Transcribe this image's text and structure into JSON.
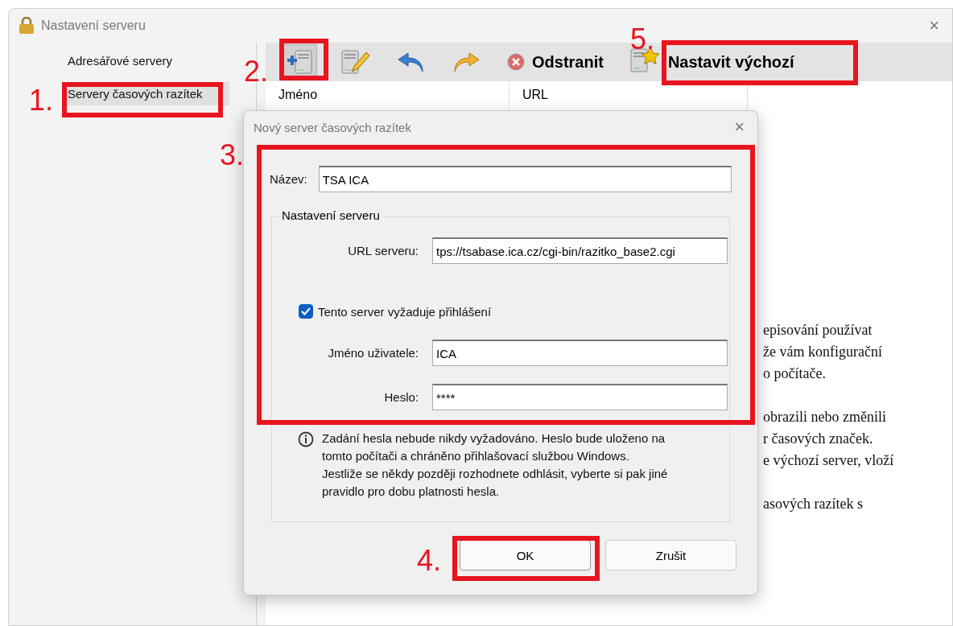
{
  "window": {
    "title": "Nastavení serveru",
    "close": "×"
  },
  "sidebar": {
    "items": [
      {
        "label": "Adresářové servery",
        "selected": false
      },
      {
        "label": "Servery časových razítek",
        "selected": true
      }
    ]
  },
  "toolbar": [
    {
      "kind": "add",
      "selected": true
    },
    {
      "kind": "edit",
      "selected": false
    },
    {
      "kind": "undo",
      "selected": false
    },
    {
      "kind": "redo",
      "selected": false
    },
    {
      "kind": "delete",
      "label": "Odstranit",
      "selected": false
    },
    {
      "kind": "default",
      "label": "Nastavit výchozí",
      "selected": false
    }
  ],
  "table": {
    "columns": [
      "Jméno",
      "URL"
    ]
  },
  "help_text": [
    {
      "lines": [
        "episování používat",
        "že vám konfigurační",
        "o počítače."
      ]
    },
    {
      "lines": [
        "obrazili nebo změnili",
        "r časových značek.",
        "e výchozí server, vloží"
      ]
    },
    {
      "lines": [
        "asových razítek s"
      ]
    }
  ],
  "dialog": {
    "title": "Nový server časových razítek",
    "close": "×",
    "name": {
      "label": "Název:",
      "value": "TSA ICA"
    },
    "group_title": "Nastavení serveru",
    "url": {
      "label": "URL serveru:",
      "value": "tps://tsabase.ica.cz/cgi-bin/razitko_base2.cgi"
    },
    "login_required": {
      "label": "Tento server vyžaduje přihlášení",
      "checked": true
    },
    "username": {
      "label": "Jméno uživatele:",
      "value": "ICA"
    },
    "password": {
      "label": "Heslo:",
      "value": "****"
    },
    "info": "Zadání hesla nebude nikdy vyžadováno. Heslo bude uloženo na tomto počítači a chráněno přihlašovací službou Windows.\nJestliže se někdy později rozhodnete odhlásit, vyberte si pak jiné pravidlo pro dobu platnosti hesla.",
    "buttons": [
      {
        "label": "OK",
        "kind": "default"
      },
      {
        "label": "Zrušit",
        "kind": "cancel"
      }
    ]
  },
  "annotations": [
    {
      "label": "1."
    },
    {
      "label": "2."
    },
    {
      "label": "3."
    },
    {
      "label": "4."
    },
    {
      "label": "5."
    }
  ]
}
